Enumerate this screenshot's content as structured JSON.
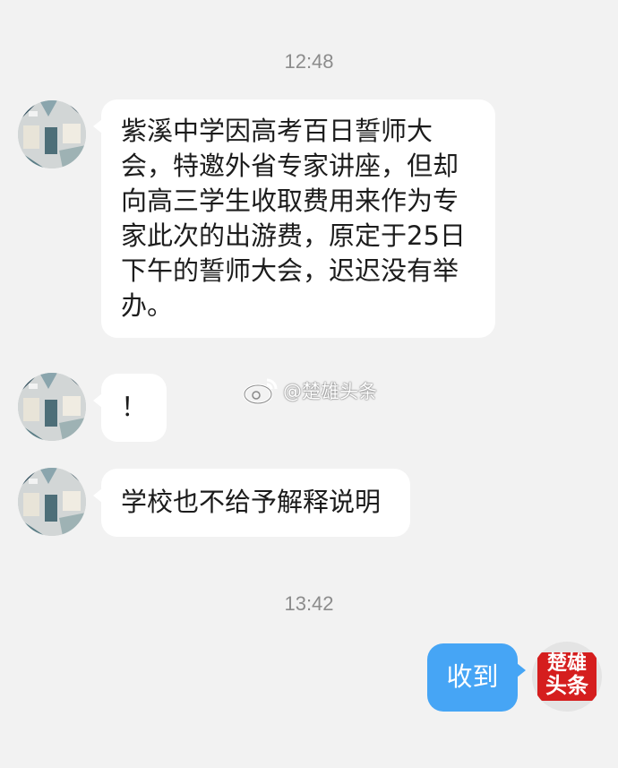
{
  "chat": {
    "timestamps": [
      "12:48",
      "13:42"
    ],
    "messages": [
      {
        "from": "other",
        "text": "紫溪中学因高考百日誓师大会，特邀外省专家讲座，但却向高三学生收取费用来作为专家此次的出游费，原定于25日下午的誓师大会，迟迟没有举办。"
      },
      {
        "from": "other",
        "text": "！"
      },
      {
        "from": "other",
        "text": "学校也不给予解释说明"
      },
      {
        "from": "self",
        "text": "收到"
      }
    ]
  },
  "self_avatar": {
    "line1": "楚雄",
    "line2": "头条"
  },
  "watermark": {
    "text": "@楚雄头条"
  },
  "colors": {
    "background": "#f2f2f2",
    "incoming_bubble": "#ffffff",
    "outgoing_bubble": "#46a5f5",
    "logo_red": "#d51e1e"
  },
  "icons": {
    "contact_avatar": "contact-avatar-photo",
    "self_avatar": "chuxiong-toutiao-logo",
    "watermark": "weibo-icon"
  }
}
